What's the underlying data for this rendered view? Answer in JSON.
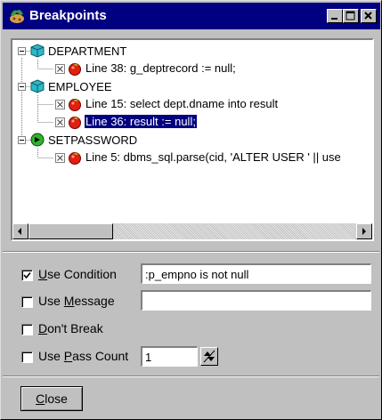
{
  "window": {
    "title": "Breakpoints"
  },
  "tree": {
    "nodes": [
      {
        "name": "DEPARTMENT",
        "icon": "package-icon",
        "breakpoints": [
          {
            "label": "Line 38: g_deptrecord := null;",
            "selected": false
          }
        ]
      },
      {
        "name": "EMPLOYEE",
        "icon": "package-icon",
        "breakpoints": [
          {
            "label": "Line 15: select dept.dname into result",
            "selected": false
          },
          {
            "label": "Line 36: result := null;",
            "selected": true
          }
        ]
      },
      {
        "name": "SETPASSWORD",
        "icon": "procedure-icon",
        "breakpoints": [
          {
            "label": "Line 5: dbms_sql.parse(cid, 'ALTER USER ' || use",
            "selected": false
          }
        ]
      }
    ]
  },
  "options": {
    "use_condition": {
      "checked": true,
      "label_u": "U",
      "label_rest": "se Condition",
      "value": ":p_empno is not null"
    },
    "use_message": {
      "checked": false,
      "label_pre": "Use ",
      "label_u": "M",
      "label_rest": "essage",
      "value": ""
    },
    "dont_break": {
      "checked": false,
      "label_u": "D",
      "label_rest": "on't Break"
    },
    "use_pass_count": {
      "checked": false,
      "label_pre": "Use ",
      "label_u": "P",
      "label_rest": "ass Count",
      "value": "1"
    }
  },
  "close_button": {
    "label_u": "C",
    "label_rest": "lose"
  }
}
